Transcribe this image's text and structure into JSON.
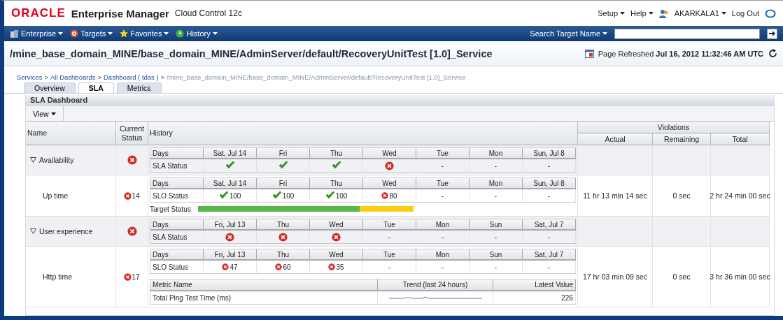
{
  "header": {
    "logo": "ORACLE",
    "product": "Enterprise Manager",
    "edition": "Cloud Control 12c",
    "menus": [
      "Setup",
      "Help"
    ],
    "user": "AKARKALA1",
    "logout": "Log Out"
  },
  "nav": {
    "menus": [
      {
        "label": "Enterprise",
        "kind": "enterprise"
      },
      {
        "label": "Targets",
        "kind": "targets"
      },
      {
        "label": "Favorites",
        "kind": "favorites"
      },
      {
        "label": "History",
        "kind": "history"
      }
    ],
    "search_label": "Search Target Name"
  },
  "page": {
    "title": "/mine_base_domain_MINE/base_domain_MINE/AdminServer/default/RecoveryUnitTest [1.0]_Service",
    "refreshed_label": "Page Refreshed",
    "refreshed_time": "Jul 16, 2012 11:32:46 AM UTC"
  },
  "breadcrumb": [
    {
      "kind": "link",
      "label": "Services"
    },
    {
      "kind": "sep",
      "label": ">"
    },
    {
      "kind": "link",
      "label": "All Dashboards"
    },
    {
      "kind": "sep",
      "label": ">"
    },
    {
      "kind": "link",
      "label": "Dashboard ( tdas )"
    },
    {
      "kind": "sep",
      "label": ">"
    },
    {
      "kind": "current",
      "label": "/mine_base_domain_MINE/base_domain_MINE/AdminServer/default/RecoveryUnitTest [1.0]_Service"
    }
  ],
  "tabs": [
    {
      "label": "Overview",
      "selected": false
    },
    {
      "label": "SLA",
      "selected": true
    },
    {
      "label": "Metrics",
      "selected": false
    }
  ],
  "panel": {
    "title": "SLA Dashboard",
    "view_menu": "View"
  },
  "columns": {
    "name": "Name",
    "status": "Current Status",
    "history": "History",
    "violations": "Violations",
    "actual": "Actual",
    "remaining": "Remaining",
    "total": "Total"
  },
  "rows": [
    {
      "kind": "sla",
      "name": "Availability",
      "expanded": true,
      "failed": true,
      "days_label": "Days",
      "status_label": "SLA Status",
      "days": [
        "Sat, Jul 14",
        "Fri",
        "Thu",
        "Wed",
        "Tue",
        "Mon",
        "Sun, Jul 8"
      ],
      "results": [
        {
          "kind": "ok"
        },
        {
          "kind": "ok"
        },
        {
          "kind": "ok"
        },
        {
          "kind": "fail"
        },
        {
          "kind": "none",
          "text": "-"
        },
        {
          "kind": "none",
          "text": "-"
        },
        {
          "kind": "none",
          "text": "-"
        }
      ]
    },
    {
      "kind": "slo",
      "name": "Up time",
      "failed": true,
      "count": "14",
      "days_label": "Days",
      "status_label": "SLO Status",
      "days": [
        "Sat, Jul 14",
        "Fri",
        "Thu",
        "Wed",
        "Tue",
        "Mon",
        "Sun, Jul 8"
      ],
      "results": [
        {
          "kind": "ok",
          "text": "100"
        },
        {
          "kind": "ok",
          "text": "100"
        },
        {
          "kind": "ok",
          "text": "100"
        },
        {
          "kind": "fail",
          "text": "80"
        },
        {
          "kind": "none",
          "text": "-"
        },
        {
          "kind": "none",
          "text": "-"
        },
        {
          "kind": "none",
          "text": "-"
        }
      ],
      "target": {
        "label": "Target Status",
        "level": 0.75
      },
      "actual": "11 hr 13 min 14 sec",
      "remaining": "0 sec",
      "total": "2 hr 24 min 00 sec"
    },
    {
      "kind": "sla",
      "name": "User experience",
      "expanded": true,
      "failed": true,
      "days_label": "Days",
      "status_label": "SLA Status",
      "days": [
        "Fri, Jul 13",
        "Thu",
        "Wed",
        "Tue",
        "Mon",
        "Sun",
        "Sat, Jul 7"
      ],
      "results": [
        {
          "kind": "fail"
        },
        {
          "kind": "fail"
        },
        {
          "kind": "fail"
        },
        {
          "kind": "none",
          "text": "-"
        },
        {
          "kind": "none",
          "text": "-"
        },
        {
          "kind": "none",
          "text": "-"
        },
        {
          "kind": "none",
          "text": "-"
        }
      ]
    },
    {
      "kind": "slo",
      "name": "Http time",
      "failed": true,
      "count": "17",
      "days_label": "Days",
      "status_label": "SLO Status",
      "days": [
        "Fri, Jul 13",
        "Thu",
        "Wed",
        "Tue",
        "Mon",
        "Sun",
        "Sat, Jul 7"
      ],
      "results": [
        {
          "kind": "fail",
          "text": "47"
        },
        {
          "kind": "fail",
          "text": "60"
        },
        {
          "kind": "fail",
          "text": "35"
        },
        {
          "kind": "none",
          "text": "-"
        },
        {
          "kind": "none",
          "text": "-"
        },
        {
          "kind": "none",
          "text": "-"
        },
        {
          "kind": "none",
          "text": "-"
        }
      ],
      "metrics": {
        "columns": [
          "Metric Name",
          "Trend (last 24 hours)",
          "Latest Value"
        ],
        "rows": [
          {
            "name": "Total Ping Test Time (ms)",
            "latest": "226"
          }
        ]
      },
      "actual": "17 hr 03 min 09 sec",
      "remaining": "0 sec",
      "total": "3 hr 36 min 00 sec"
    }
  ]
}
